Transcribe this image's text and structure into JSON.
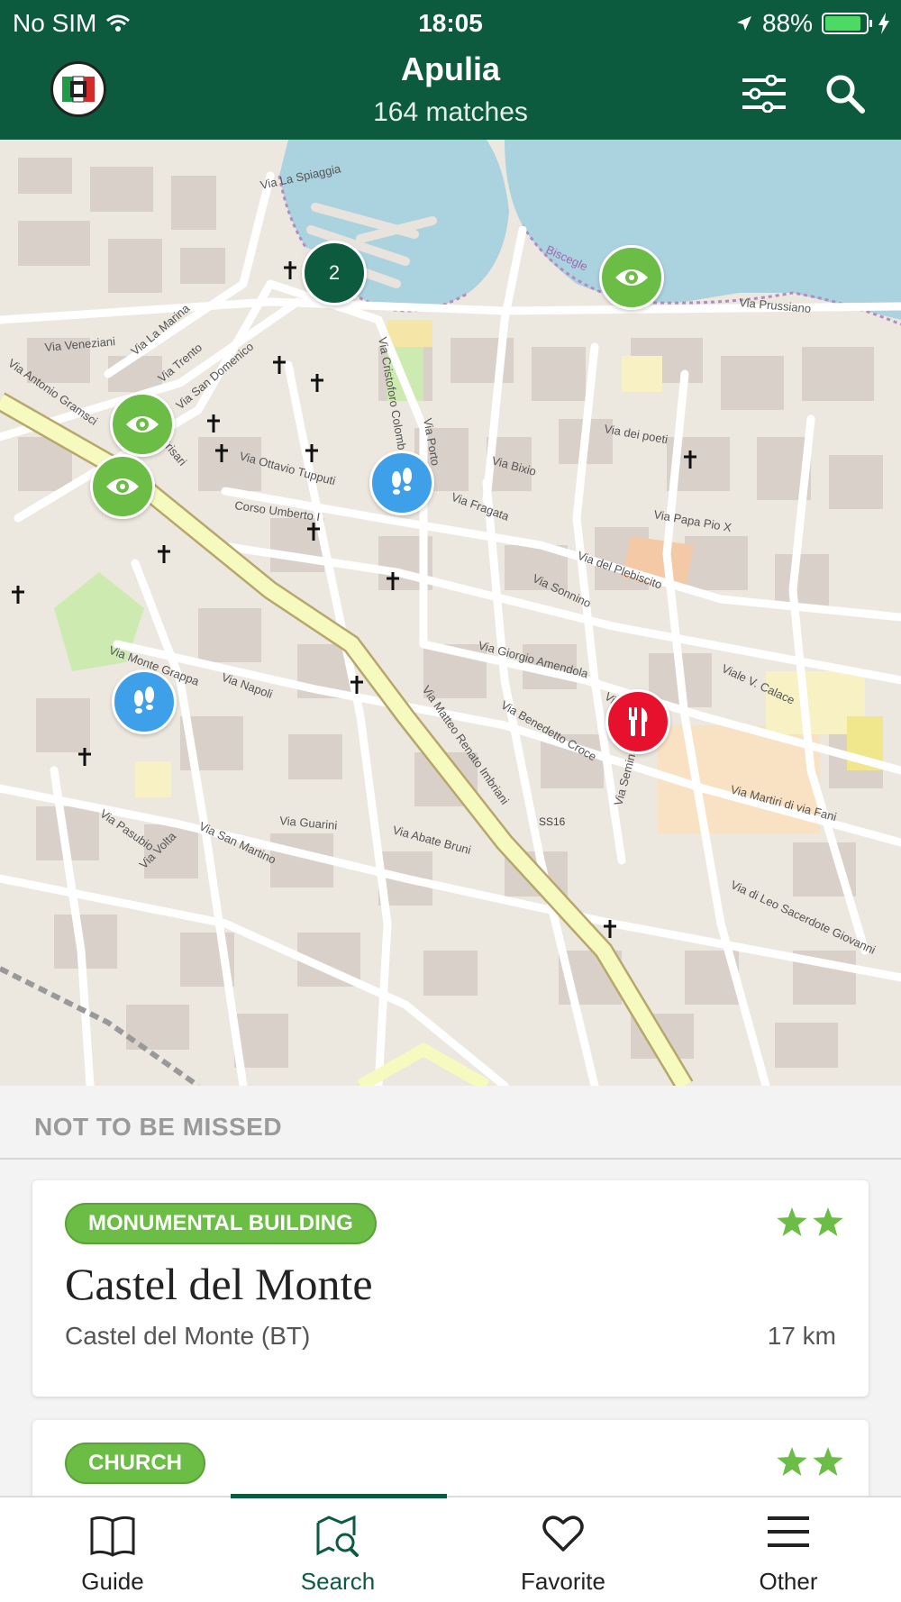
{
  "status": {
    "carrier": "No SIM",
    "time": "18:05",
    "battery": "88%",
    "battery_level": 0.88
  },
  "header": {
    "title": "Apulia",
    "subtitle": "164 matches"
  },
  "map": {
    "streets": [
      "Via La Spiaggia",
      "Via Prussiano",
      "Via Veneziani",
      "Via Antonio Gramsci",
      "Via La Marina",
      "Via Trento",
      "Via San Domenico",
      "Via Giulio Frisari",
      "Via Ottavio Tupputi",
      "Corso Umberto I",
      "Via Cristoforo Colombo",
      "Via Porto",
      "Via Fragata",
      "Via Bixio",
      "Via dei poeti",
      "Via Papa Pio X",
      "Via Sonnino",
      "Via del Plebiscito",
      "Via Giorgio Amendola",
      "Via Monte Grappa",
      "Via Napoli",
      "Via Matteo Renato Imbriani",
      "Via Benedetto Croce",
      "Via Raffaello",
      "Viale V. Calace",
      "Via Martiri di via Fani",
      "Via Guarini",
      "Via Abate Bruni",
      "Via San Martino",
      "Via Pasubio",
      "Via Volta",
      "Via di Leo Sacerdote Giovanni",
      "Via Seminario",
      "SS16",
      "Biscegle"
    ],
    "cluster_count": "2",
    "markers": [
      {
        "type": "cluster",
        "label": "2"
      },
      {
        "type": "sight",
        "icon": "eye-icon"
      },
      {
        "type": "sight",
        "icon": "eye-icon"
      },
      {
        "type": "sight",
        "icon": "eye-icon"
      },
      {
        "type": "walk",
        "icon": "footsteps-icon"
      },
      {
        "type": "walk",
        "icon": "footsteps-icon"
      },
      {
        "type": "food",
        "icon": "fork-knife-icon"
      }
    ]
  },
  "section": {
    "title": "NOT TO BE MISSED",
    "cards": [
      {
        "category": "MONUMENTAL BUILDING",
        "title": "Castel del Monte",
        "place": "Castel del Monte (BT)",
        "distance": "17 km",
        "stars": 2
      },
      {
        "category": "CHURCH",
        "stars": 2
      }
    ]
  },
  "tabs": [
    {
      "label": "Guide",
      "icon": "book-icon"
    },
    {
      "label": "Search",
      "icon": "map-search-icon",
      "active": true
    },
    {
      "label": "Favorite",
      "icon": "heart-icon"
    },
    {
      "label": "Other",
      "icon": "menu-icon"
    }
  ],
  "colors": {
    "brand": "#0c5b3e",
    "accent_green": "#6cbd45",
    "walk_blue": "#3fa0ea",
    "food_red": "#e8112d"
  }
}
